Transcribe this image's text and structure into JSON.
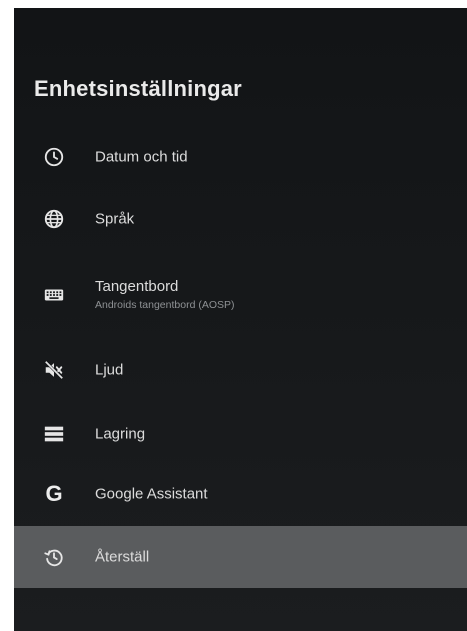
{
  "page": {
    "title": "Enhetsinställningar"
  },
  "menu": {
    "items": [
      {
        "label": "Datum och tid",
        "icon": "clock-icon"
      },
      {
        "label": "Språk",
        "icon": "globe-icon"
      },
      {
        "label": "Tangentbord",
        "sublabel": "Androids tangentbord (AOSP)",
        "icon": "keyboard-icon"
      },
      {
        "label": "Ljud",
        "icon": "sound-off-icon"
      },
      {
        "label": "Lagring",
        "icon": "storage-icon"
      },
      {
        "label": "Google Assistant",
        "icon": "google-g-icon",
        "icon_text": "G"
      },
      {
        "label": "Återställ",
        "icon": "reset-history-icon",
        "selected": true
      }
    ]
  },
  "colors": {
    "background": "#17191b",
    "selected_row": "#5a5c5e",
    "text_primary": "#dcdcdc",
    "text_secondary": "#8e9194"
  }
}
